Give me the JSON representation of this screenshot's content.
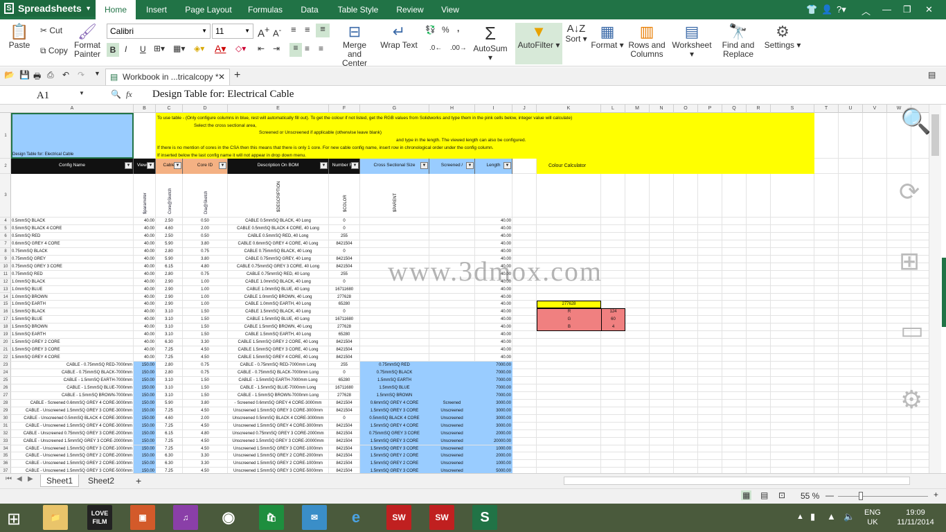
{
  "app": {
    "title": "Spreadsheets"
  },
  "menu_tabs": [
    "Home",
    "Insert",
    "Page Layout",
    "Formulas",
    "Data",
    "Table Style",
    "Review",
    "View"
  ],
  "ribbon": {
    "paste": "Paste",
    "cut": "Cut",
    "copy": "Copy",
    "format_painter": "Format Painter",
    "font_name": "Calibri",
    "font_size": "11",
    "merge_center": "Merge and Center",
    "wrap_text": "Wrap Text",
    "autosum": "AutoSum",
    "autofilter": "AutoFilter",
    "sort": "Sort",
    "format": "Format",
    "rows_columns": "Rows and Columns",
    "worksheet": "Worksheet",
    "find_replace": "Find and Replace",
    "settings": "Settings",
    "number_percent": "%",
    "number_comma": ","
  },
  "doc_tab": {
    "title": "Workbook in ...tricalcopy *"
  },
  "formula_bar": {
    "cell_ref": "A1",
    "fx": "fx",
    "content": "Design Table for: Electrical Cable"
  },
  "columns": [
    "A",
    "B",
    "C",
    "D",
    "E",
    "F",
    "G",
    "H",
    "I",
    "J",
    "K",
    "L",
    "M",
    "N",
    "O",
    "P",
    "Q",
    "R",
    "S",
    "T",
    "U",
    "V",
    "W"
  ],
  "instructions": [
    "To use table - (Only configure columns in blue, rest will automatically fill out). To get the colour if not listed, get the RGB values from Solidworks and type them in the pink cells below, integer value will calculate)",
    "Select the cross sectional area,",
    "Screened or Unscreened if applicable (otherwise leave blank)",
    "and type in the length.    The viewed length can also be configured.",
    "If there is no mention of cores in the CSA then this means that there is only 1 core.  For new cable config name, insert row in chronological order under the config column.",
    "If inserted below the last config name it will not appear in drop down menu."
  ],
  "a1_label": "Design Table for: Electrical Cable",
  "headers": [
    "Config Name",
    "Viewed Len",
    "Cable",
    "Core ID",
    "Description On BOM",
    "Number For Colour",
    "Cross Sectional Size",
    "Screened / Unscreened",
    "Length"
  ],
  "colour_calc": {
    "title": "Colour Calculator",
    "value": "277628",
    "r_label": "R",
    "g_label": "G",
    "b_label": "B",
    "r": "124",
    "g": "60",
    "b": "4"
  },
  "row3": [
    "$DESCRIPTION",
    "$COLOR",
    "$PARENT"
  ],
  "rows": [
    [
      "0.5mmSQ BLACK",
      "40.00",
      "2.50",
      "0.50",
      "CABLE 0.5mmSQ BLACK, 40 Long",
      "0",
      "",
      "",
      "40.00"
    ],
    [
      "0.5mmSQ BLACK 4 CORE",
      "40.00",
      "4.60",
      "2.00",
      "CABLE 0.5mmSQ BLACK 4 CORE, 40 Long",
      "0",
      "",
      "",
      "40.00"
    ],
    [
      "0.5mmSQ RED",
      "40.00",
      "2.50",
      "0.50",
      "CABLE 0.5mmSQ RED, 40 Long",
      "255",
      "",
      "",
      "40.00"
    ],
    [
      "0.6mmSQ GREY 4 CORE",
      "40.00",
      "5.90",
      "3.80",
      "CABLE 0.6mmSQ GREY 4 CORE, 40 Long",
      "8421504",
      "",
      "",
      "40.00"
    ],
    [
      "0.75mmSQ BLACK",
      "40.00",
      "2.80",
      "0.75",
      "CABLE 0.75mmSQ BLACK, 40 Long",
      "0",
      "",
      "",
      "40.00"
    ],
    [
      "0.75mmSQ GREY",
      "40.00",
      "5.90",
      "3.80",
      "CABLE 0.75mmSQ GREY, 40 Long",
      "8421504",
      "",
      "",
      "40.00"
    ],
    [
      "0.75mmSQ GREY 3 CORE",
      "40.00",
      "6.15",
      "4.80",
      "CABLE 0.75mmSQ GREY 3 CORE, 40 Long",
      "8421504",
      "",
      "",
      "40.00"
    ],
    [
      "0.75mmSQ RED",
      "40.00",
      "2.80",
      "0.75",
      "CABLE 0.75mmSQ RED, 40 Long",
      "255",
      "",
      "",
      "40.00"
    ],
    [
      "1.0mmSQ BLACK",
      "40.00",
      "2.90",
      "1.00",
      "CABLE 1.0mmSQ BLACK, 40 Long",
      "0",
      "",
      "",
      "40.00"
    ],
    [
      "1.0mmSQ BLUE",
      "40.00",
      "2.90",
      "1.00",
      "CABLE 1.0mmSQ BLUE, 40 Long",
      "16711680",
      "",
      "",
      "40.00"
    ],
    [
      "1.0mmSQ BROWN",
      "40.00",
      "2.90",
      "1.00",
      "CABLE 1.0mmSQ BROWN, 40 Long",
      "277628",
      "",
      "",
      "40.00"
    ],
    [
      "1.0mmSQ EARTH",
      "40.00",
      "2.90",
      "1.00",
      "CABLE 1.0mmSQ EARTH, 40 Long",
      "65280",
      "",
      "",
      "40.00"
    ],
    [
      "1.5mmSQ BLACK",
      "40.00",
      "3.10",
      "1.50",
      "CABLE 1.5mmSQ BLACK, 40 Long",
      "0",
      "",
      "",
      "40.00"
    ],
    [
      "1.5mmSQ BLUE",
      "40.00",
      "3.10",
      "1.50",
      "CABLE 1.5mmSQ BLUE, 40 Long",
      "16711680",
      "",
      "",
      "40.00"
    ],
    [
      "1.5mmSQ BROWN",
      "40.00",
      "3.10",
      "1.50",
      "CABLE 1.5mmSQ BROWN, 40 Long",
      "277628",
      "",
      "",
      "40.00"
    ],
    [
      "1.5mmSQ EARTH",
      "40.00",
      "3.10",
      "1.50",
      "CABLE 1.5mmSQ EARTH, 40 Long",
      "65280",
      "",
      "",
      "40.00"
    ],
    [
      "1.5mmSQ GREY 2 CORE",
      "40.00",
      "6.30",
      "3.30",
      "CABLE 1.5mmSQ GREY 2 CORE, 40 Long",
      "8421504",
      "",
      "",
      "40.00"
    ],
    [
      "1.5mmSQ GREY 3 CORE",
      "40.00",
      "7.25",
      "4.50",
      "CABLE 1.5mmSQ GREY 3 CORE, 40 Long",
      "8421504",
      "",
      "",
      "40.00"
    ],
    [
      "1.5mmSQ GREY 4 CORE",
      "40.00",
      "7.25",
      "4.50",
      "CABLE 1.5mmSQ GREY 4 CORE, 40 Long",
      "8421504",
      "",
      "",
      "40.00"
    ],
    [
      "CABLE - 0.75mmSQ RED-7000mm",
      "150.00",
      "2.80",
      "0.75",
      "CABLE - 0.75mmSQ RED-7000mm Long",
      "255",
      "0.75mmSQ RED",
      "",
      "7000.00"
    ],
    [
      "CABLE - 0.75mmSQ BLACK-7000mm",
      "150.00",
      "2.80",
      "0.75",
      "CABLE - 0.75mmSQ BLACK-7000mm Long",
      "0",
      "0.75mmSQ BLACK",
      "",
      "7000.00"
    ],
    [
      "CABLE - 1.5mmSQ EARTH-7000mm",
      "150.00",
      "3.10",
      "1.50",
      "CABLE - 1.5mmSQ EARTH-7000mm Long",
      "65280",
      "1.5mmSQ EARTH",
      "",
      "7000.00"
    ],
    [
      "CABLE - 1.5mmSQ BLUE-7000mm",
      "150.00",
      "3.10",
      "1.50",
      "CABLE - 1.5mmSQ BLUE-7000mm Long",
      "16711680",
      "1.5mmSQ BLUE",
      "",
      "7000.00"
    ],
    [
      "CABLE - 1.5mmSQ BROWN-7000mm",
      "150.00",
      "3.10",
      "1.50",
      "CABLE - 1.5mmSQ BROWN-7000mm Long",
      "277628",
      "1.5mmSQ BROWN",
      "",
      "7000.00"
    ],
    [
      "CABLE - Screened 0.6mmSQ GREY 4 CORE-3000mm",
      "150.00",
      "5.90",
      "3.80",
      "- Screened 0.6mmSQ GREY 4 CORE-3000mm",
      "8421504",
      "0.6mmSQ GREY 4 CORE",
      "Screened",
      "3000.00"
    ],
    [
      "CABLE - Unscreened 1.5mmSQ GREY 3 CORE-3000mm",
      "150.00",
      "7.25",
      "4.50",
      "Unscreened 1.5mmSQ GREY 3 CORE-3000mm",
      "8421504",
      "1.5mmSQ GREY 3 CORE",
      "Unscreened",
      "3000.00"
    ],
    [
      "CABLE - Unscreened 0.5mmSQ BLACK 4 CORE-3000mm",
      "150.00",
      "4.60",
      "2.00",
      "Unscreened 0.5mmSQ BLACK 4 CORE-3000mm",
      "0",
      "0.5mmSQ BLACK 4 CORE",
      "Unscreened",
      "3000.00"
    ],
    [
      "CABLE - Unscreened 1.5mmSQ GREY 4 CORE-3000mm",
      "150.00",
      "7.25",
      "4.50",
      "Unscreened 1.5mmSQ GREY 4 CORE-3000mm",
      "8421504",
      "1.5mmSQ GREY 4 CORE",
      "Unscreened",
      "3000.00"
    ],
    [
      "CABLE - Unscreened 0.75mmSQ GREY 3 CORE-2000mm",
      "150.00",
      "6.15",
      "4.80",
      "Unscreened 0.75mmSQ GREY 3 CORE-2000mm",
      "8421504",
      "0.75mmSQ GREY 3 CORE",
      "Unscreened",
      "2000.00"
    ],
    [
      "CABLE - Unscreened 1.5mmSQ GREY 3 CORE-20000mm",
      "150.00",
      "7.25",
      "4.50",
      "Unscreened 1.5mmSQ GREY 3 CORE-20000mm",
      "8421504",
      "1.5mmSQ GREY 3 CORE",
      "Unscreened",
      "20000.00"
    ],
    [
      "CABLE - Unscreened 1.5mmSQ GREY 3 CORE-1000mm",
      "150.00",
      "7.25",
      "4.50",
      "Unscreened 1.5mmSQ GREY 3 CORE-1000mm",
      "8421504",
      "1.5mmSQ GREY 3 CORE",
      "Unscreened",
      "1000.00"
    ],
    [
      "CABLE - Unscreened 1.5mmSQ GREY 2 CORE-2000mm",
      "150.00",
      "6.30",
      "3.30",
      "Unscreened 1.5mmSQ GREY 2 CORE-2000mm",
      "8421504",
      "1.5mmSQ GREY 2 CORE",
      "Unscreened",
      "2000.00"
    ],
    [
      "CABLE - Unscreened 1.5mmSQ GREY 2 CORE-1000mm",
      "150.00",
      "6.30",
      "3.30",
      "Unscreened 1.5mmSQ GREY 2 CORE-1000mm",
      "8421504",
      "1.5mmSQ GREY 2 CORE",
      "Unscreened",
      "1000.00"
    ],
    [
      "CABLE - Unscreened 1.5mmSQ GREY 3 CORE-5000mm",
      "150.00",
      "7.25",
      "4.50",
      "Unscreened 1.5mmSQ GREY 3 CORE-5000mm",
      "8421504",
      "1.5mmSQ GREY 3 CORE",
      "Unscreened",
      "5000.00"
    ]
  ],
  "watermark": "www.3dmox.com",
  "sheet_tabs": [
    "Sheet1",
    "Sheet2"
  ],
  "status": {
    "zoom": "55 %"
  },
  "taskbar": {
    "lang": "ENG",
    "region": "UK",
    "time": "19:09",
    "date": "11/11/2014"
  },
  "colors": {
    "brand": "#217346",
    "yellow": "#ffff00",
    "blue_cell": "#99ccff",
    "header_black": "#111111",
    "pink": "#f08080"
  }
}
